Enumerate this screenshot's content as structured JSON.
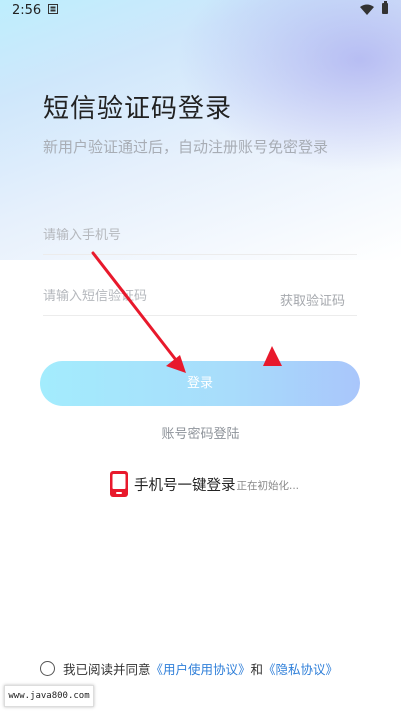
{
  "status_bar": {
    "time": "2:56"
  },
  "header": {
    "title": "短信验证码登录",
    "subtitle": "新用户验证通过后，自动注册账号免密登录"
  },
  "form": {
    "phone_placeholder": "请输入手机号",
    "code_placeholder": "请输入短信验证码",
    "get_code_label": "获取验证码",
    "login_button": "登录",
    "password_login": "账号密码登陆"
  },
  "one_click": {
    "label": "手机号一键登录",
    "state": "正在初始化..."
  },
  "agreement": {
    "prefix": "我已阅读并同意",
    "user_agreement": "《用户使用协议》",
    "and": "和",
    "privacy": "《隐私协议》"
  },
  "watermark": "www.java800.com",
  "colors": {
    "accent_link": "#2f7fd9",
    "button_gradient_start": "#a3ecfd",
    "button_gradient_end": "#a9c6fb",
    "arrow": "#e8192c",
    "phone_icon": "#e8192c"
  },
  "icons": {
    "status_note": "notification-icon",
    "wifi": "wifi-icon",
    "battery": "battery-icon",
    "one_click": "phone-icon",
    "agreement_radio": "radio-icon"
  }
}
